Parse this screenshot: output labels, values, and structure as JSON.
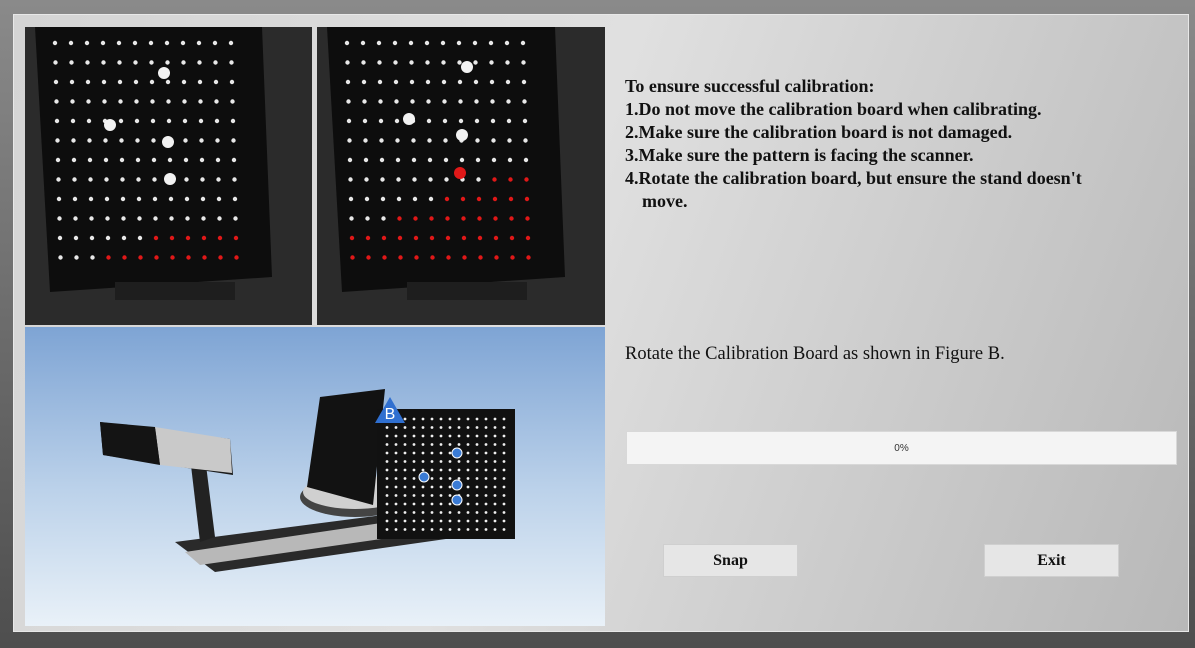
{
  "instructions": {
    "heading": "To ensure successful calibration:",
    "items": [
      "1.Do not move the calibration board when calibrating.",
      "2.Make sure the calibration board is not damaged.",
      "3.Make sure the pattern is facing the scanner.",
      "4.Rotate the calibration board, but ensure the stand doesn't",
      "move."
    ]
  },
  "prompt": "Rotate the Calibration Board as shown in Figure B.",
  "progress": {
    "label": "0%",
    "value": 0
  },
  "buttons": {
    "snap": "Snap",
    "exit": "Exit"
  },
  "figure": {
    "badge": "B"
  },
  "colors": {
    "detected_dot": "#e01818",
    "marker_dot": "#3a7bd5",
    "figure_bg": "#bcd2ea"
  }
}
